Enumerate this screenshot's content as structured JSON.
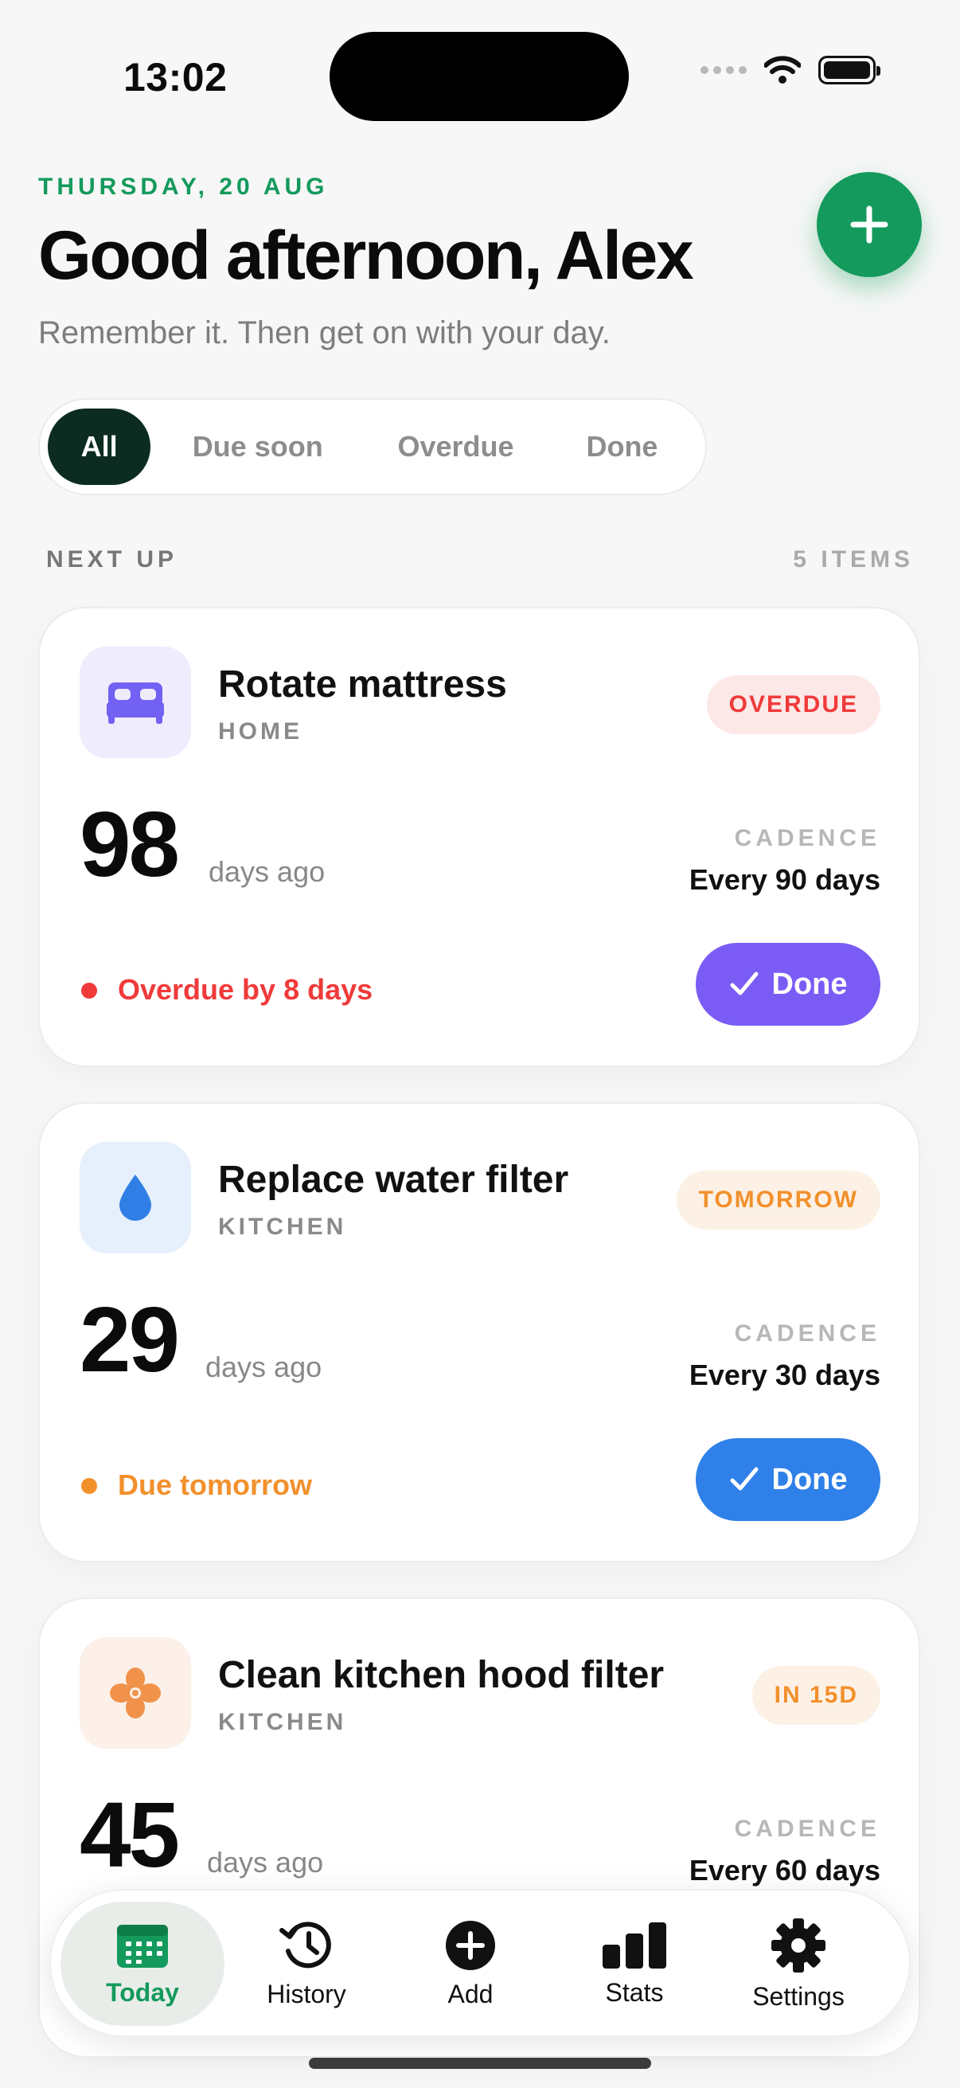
{
  "status_bar": {
    "time": "13:02"
  },
  "header": {
    "date": "THURSDAY, 20 AUG",
    "greeting": "Good afternoon, Alex",
    "subtitle": "Remember it. Then get on with your day."
  },
  "filters": [
    {
      "label": "All",
      "active": true
    },
    {
      "label": "Due soon",
      "active": false
    },
    {
      "label": "Overdue",
      "active": false
    },
    {
      "label": "Done",
      "active": false
    }
  ],
  "section": {
    "title": "NEXT UP",
    "count": "5 ITEMS"
  },
  "tasks": [
    {
      "title": "Rotate mattress",
      "category": "HOME",
      "icon": "bed-icon",
      "badge": "OVERDUE",
      "days": "98",
      "days_label": "days ago",
      "cadence_label": "CADENCE",
      "cadence": "Every 90 days",
      "status": "Overdue by 8 days",
      "done_label": "Done",
      "colors": {
        "accent": "#f03a3a",
        "badge_bg": "#fde8e8",
        "icon_bg": "#efecfd",
        "icon": "#7261f2",
        "button": "#7a5cf5"
      }
    },
    {
      "title": "Replace water filter",
      "category": "KITCHEN",
      "icon": "water-drop-icon",
      "badge": "TOMORROW",
      "days": "29",
      "days_label": "days ago",
      "cadence_label": "CADENCE",
      "cadence": "Every 30 days",
      "status": "Due tomorrow",
      "done_label": "Done",
      "colors": {
        "accent": "#f2902c",
        "badge_bg": "#fdf1e6",
        "icon_bg": "#e6f0fc",
        "icon": "#2f7fe6",
        "button": "#2f80e8"
      }
    },
    {
      "title": "Clean kitchen hood filter",
      "category": "KITCHEN",
      "icon": "fan-icon",
      "badge": "IN 15D",
      "days": "45",
      "days_label": "days ago",
      "cadence_label": "CADENCE",
      "cadence": "Every 60 days",
      "colors": {
        "accent": "#f2902c",
        "badge_bg": "#fdf1e6",
        "icon_bg": "#fcf0e8",
        "icon": "#f0924a"
      }
    }
  ],
  "tabs": [
    {
      "label": "Today",
      "icon": "calendar-icon",
      "active": true
    },
    {
      "label": "History",
      "icon": "history-icon",
      "active": false
    },
    {
      "label": "Add",
      "icon": "add-circle-icon",
      "active": false
    },
    {
      "label": "Stats",
      "icon": "bar-chart-icon",
      "active": false
    },
    {
      "label": "Settings",
      "icon": "gear-icon",
      "active": false
    }
  ],
  "colors": {
    "brand": "#149a5c",
    "pill_active": "#0c2c22"
  }
}
